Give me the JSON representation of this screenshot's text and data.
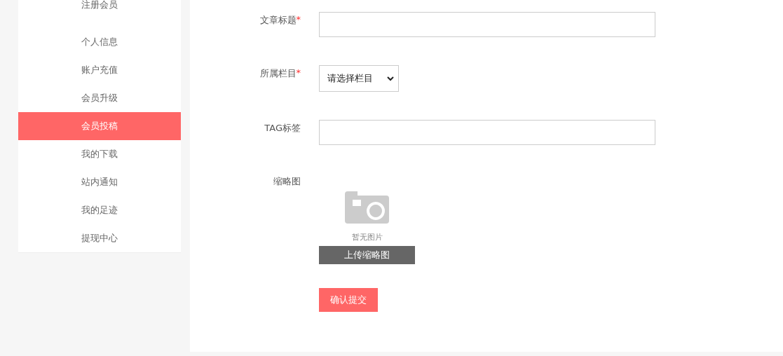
{
  "sidebar": {
    "top_item": "注册会员",
    "items": [
      {
        "label": "个人信息",
        "selected": false
      },
      {
        "label": "账户充值",
        "selected": false
      },
      {
        "label": "会员升级",
        "selected": false
      },
      {
        "label": "会员投稿",
        "selected": true
      },
      {
        "label": "我的下载",
        "selected": false
      },
      {
        "label": "站内通知",
        "selected": false
      },
      {
        "label": "我的足迹",
        "selected": false
      },
      {
        "label": "提现中心",
        "selected": false
      }
    ]
  },
  "form": {
    "fields": [
      {
        "kind": "text",
        "label": "文章标题",
        "required_mark": "*"
      },
      {
        "kind": "select",
        "label": "所属栏目",
        "required_mark": "*",
        "value": "请选择栏目"
      },
      {
        "kind": "text",
        "label": "TAG标签"
      },
      {
        "kind": "image",
        "label": "缩略图",
        "empty_text": "暂无图片",
        "upload_button": "上传缩略图"
      }
    ],
    "submit_button": "确认提交"
  }
}
